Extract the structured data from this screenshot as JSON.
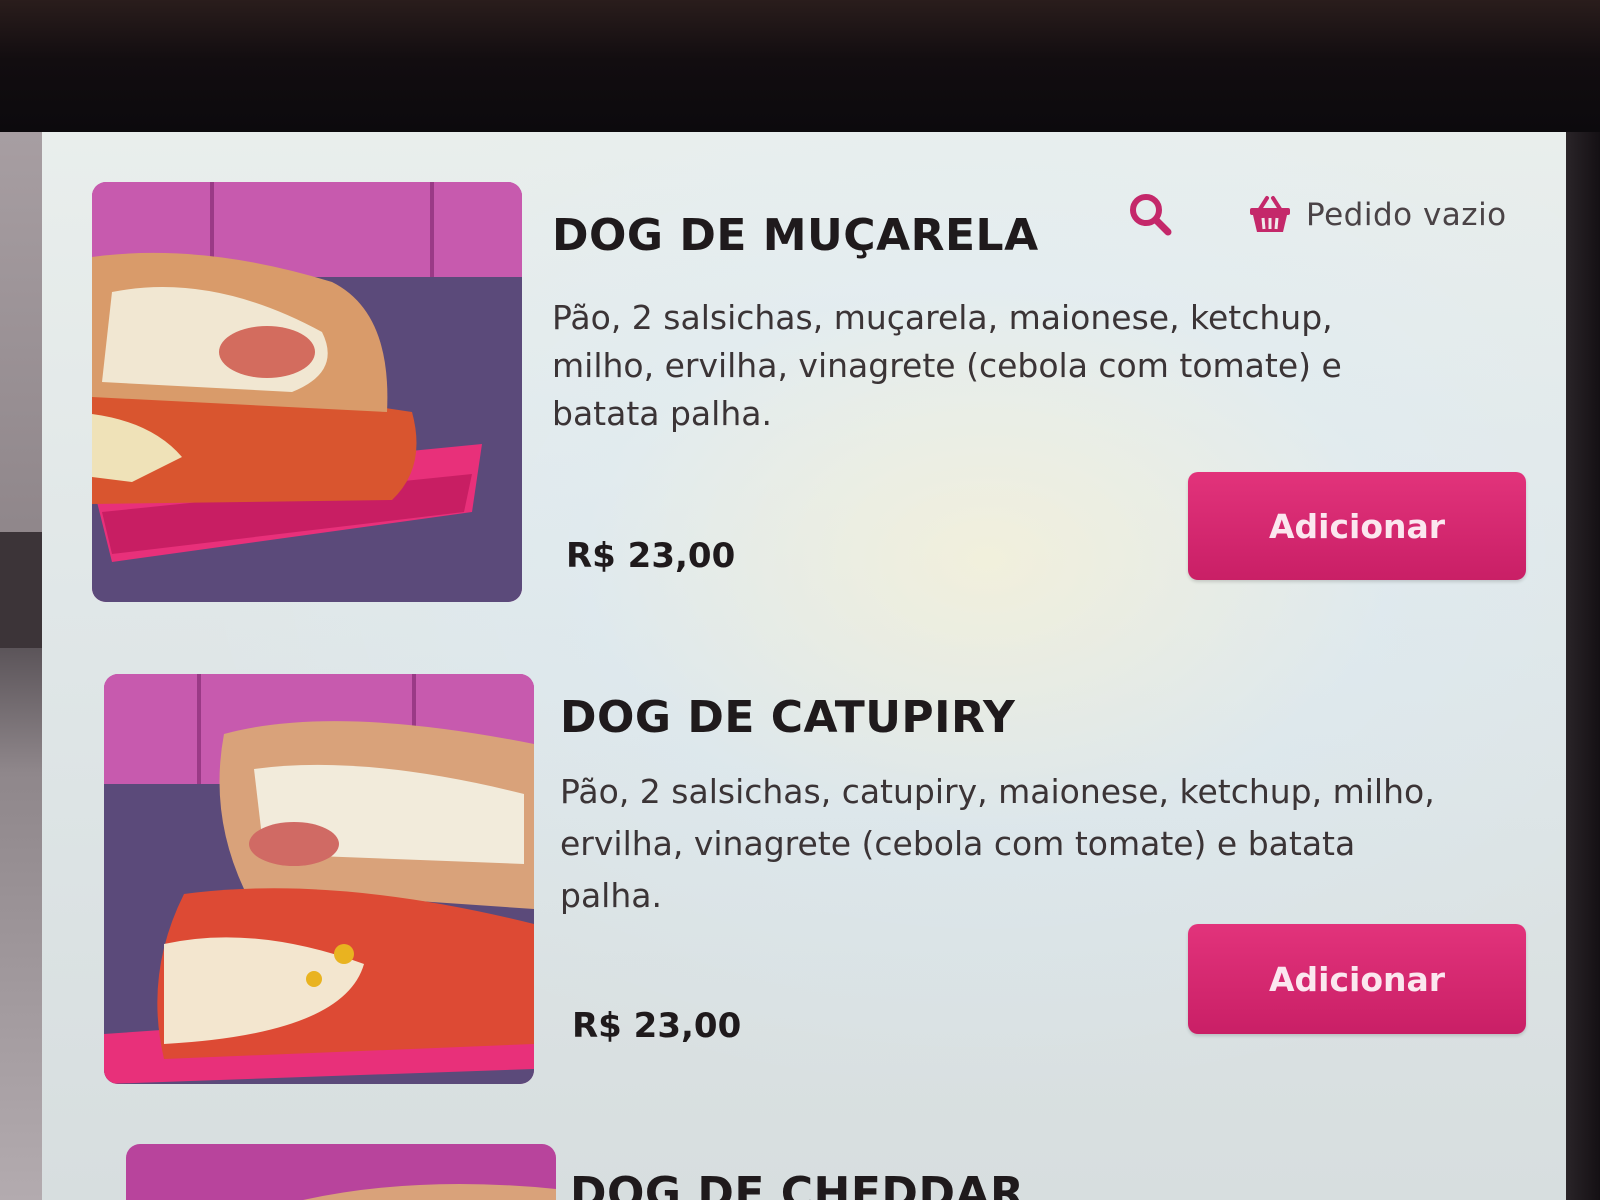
{
  "header": {
    "search_icon": "search-icon",
    "cart_icon": "basket-icon",
    "cart_label": "Pedido vazio",
    "accent_color": "#c4286a"
  },
  "products": [
    {
      "name": "DOG DE MUÇARELA",
      "description": "Pão, 2 salsichas, muçarela, maionese, ketchup, milho, ervilha, vinagrete (cebola com tomate) e batata palha.",
      "price": "R$ 23,00",
      "button_label": "Adicionar"
    },
    {
      "name": "DOG DE CATUPIRY",
      "description": "Pão, 2 salsichas, catupiry, maionese, ketchup, milho, ervilha, vinagrete (cebola com tomate) e batata palha.",
      "price": "R$ 23,00",
      "button_label": "Adicionar"
    },
    {
      "name": "DOG DE CHEDDAR"
    }
  ]
}
